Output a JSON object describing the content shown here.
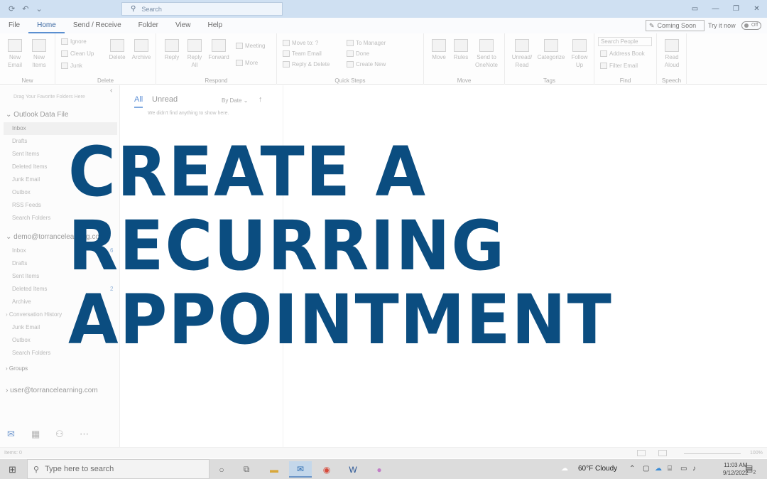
{
  "titlebar": {
    "search_placeholder": "Search",
    "icons": [
      "sync-icon",
      "undo-icon",
      "customize-icon"
    ],
    "window_controls": [
      "ribbon-display-icon",
      "minimize-icon",
      "restore-icon",
      "close-icon"
    ]
  },
  "menu": {
    "tabs": [
      "File",
      "Home",
      "Send / Receive",
      "Folder",
      "View",
      "Help"
    ],
    "active_tab": "Home",
    "coming_soon": "Coming Soon",
    "try_it_now": "Try it now",
    "toggle_state": "Off"
  },
  "ribbon": {
    "new": {
      "label": "New",
      "new_email": "New Email",
      "new_items": "New Items"
    },
    "delete": {
      "label": "Delete",
      "ignore": "Ignore",
      "clean_up": "Clean Up",
      "junk": "Junk",
      "delete": "Delete",
      "archive": "Archive"
    },
    "respond": {
      "label": "Respond",
      "reply": "Reply",
      "reply_all": "Reply All",
      "forward": "Forward",
      "meeting": "Meeting",
      "more": "More"
    },
    "quick_steps": {
      "label": "Quick Steps",
      "items": [
        "Move to: ?",
        "Team Email",
        "Reply & Delete",
        "To Manager",
        "Done",
        "Create New"
      ]
    },
    "move": {
      "label": "Move",
      "move": "Move",
      "rules": "Rules",
      "send_to_onenote": "Send to OneNote"
    },
    "tags": {
      "label": "Tags",
      "unread_read": "Unread/ Read",
      "categorize": "Categorize",
      "follow_up": "Follow Up"
    },
    "find": {
      "label": "Find",
      "search_people": "Search People",
      "address_book": "Address Book",
      "filter_email": "Filter Email"
    },
    "speech": {
      "label": "Speech",
      "read_aloud": "Read Aloud"
    }
  },
  "folders": {
    "favorites_hint": "Drag Your Favorite Folders Here",
    "data_file": {
      "name": "Outlook Data File",
      "items": [
        "Inbox",
        "Drafts",
        "Sent Items",
        "Deleted Items",
        "Junk Email",
        "Outbox",
        "RSS Feeds",
        "Search Folders"
      ]
    },
    "account": {
      "name": "demo@torrancelearning.com",
      "items": [
        "Inbox",
        "Drafts",
        "Sent Items",
        "Deleted Items",
        "Archive",
        "Conversation History",
        "Junk Email",
        "Outbox",
        "Search Folders"
      ],
      "inbox_count": "6",
      "deleted_count": "2"
    },
    "groups": "Groups",
    "user_account": "user@torrancelearning.com"
  },
  "message_list": {
    "tab_all": "All",
    "tab_unread": "Unread",
    "sort": "By Date",
    "empty_text": "We didn't find anything to show here."
  },
  "status": {
    "items": "Items: 0",
    "zoom": "100%"
  },
  "taskbar": {
    "search_placeholder": "Type here to search",
    "weather": "60°F  Cloudy",
    "time": "11:03 AM",
    "date": "9/12/2022",
    "notification_count": "2"
  },
  "overlay": {
    "line1": "CREATE A",
    "line2": "RECURRING",
    "line3": "APPOINTMENT"
  },
  "colors": {
    "overlay_text": "#0b4d80",
    "accent": "#5a8fd0",
    "titlebar": "#cfe0f2"
  }
}
